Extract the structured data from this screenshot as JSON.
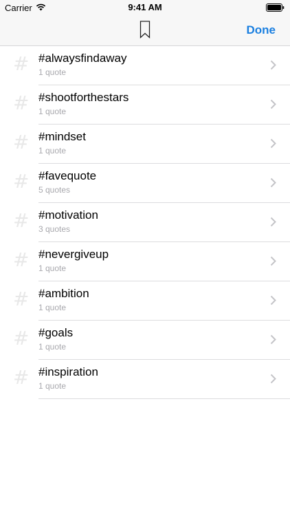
{
  "status_bar": {
    "carrier": "Carrier",
    "time": "9:41 AM"
  },
  "nav": {
    "done_label": "Done",
    "accent_color": "#1a7fe0"
  },
  "tags": [
    {
      "title": "#alwaysfindaway",
      "count": "1 quote"
    },
    {
      "title": "#shootforthestars",
      "count": "1 quote"
    },
    {
      "title": "#mindset",
      "count": "1 quote"
    },
    {
      "title": "#favequote",
      "count": "5 quotes"
    },
    {
      "title": "#motivation",
      "count": "3 quotes"
    },
    {
      "title": "#nevergiveup",
      "count": "1 quote"
    },
    {
      "title": "#ambition",
      "count": "1 quote"
    },
    {
      "title": "#goals",
      "count": "1 quote"
    },
    {
      "title": "#inspiration",
      "count": "1 quote"
    }
  ],
  "icons": {
    "tag": "hash-icon",
    "row_disclosure": "chevron-right-icon",
    "header": "bookmark-icon"
  }
}
